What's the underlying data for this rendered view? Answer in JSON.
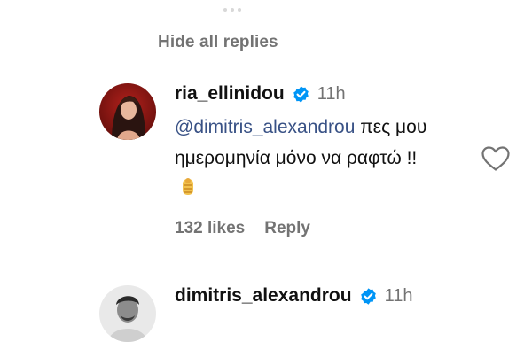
{
  "thread": {
    "hide_replies_label": "Hide all replies"
  },
  "comments": [
    {
      "username": "ria_ellinidou",
      "verified": true,
      "time": "11h",
      "mention": "@dimitris_alexandrou",
      "text": " πες μου ημερομηνία μόνο να ραφτώ !! ",
      "emoji_icon": "tailor-emoji-icon",
      "likes_label": "132 likes",
      "reply_label": "Reply"
    },
    {
      "username": "dimitris_alexandrou",
      "verified": true,
      "time": "11h"
    }
  ],
  "colors": {
    "secondary_text": "#737373",
    "mention": "#385185",
    "verified_badge": "#0095f6"
  }
}
